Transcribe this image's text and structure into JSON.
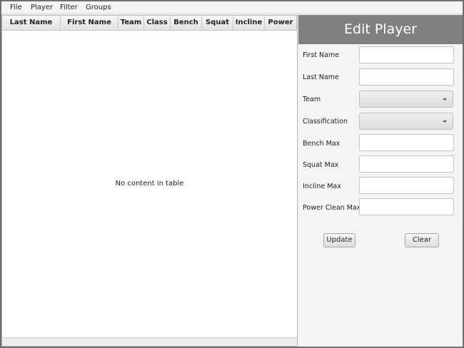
{
  "menu": [
    "File",
    "Player",
    "Filter",
    "Groups"
  ],
  "table": {
    "columns": [
      "Last Name",
      "First Name",
      "Team",
      "Class",
      "Bench",
      "Squat",
      "Incline",
      "Power"
    ],
    "empty_text": "No content in table"
  },
  "panel": {
    "title": "Edit Player",
    "fields": {
      "first_name": {
        "label": "First Name",
        "value": ""
      },
      "last_name": {
        "label": "Last Name",
        "value": ""
      },
      "team": {
        "label": "Team",
        "value": ""
      },
      "classification": {
        "label": "Classification",
        "value": ""
      },
      "bench": {
        "label": "Bench Max",
        "value": ""
      },
      "squat": {
        "label": "Squat Max",
        "value": ""
      },
      "incline": {
        "label": "Incline Max",
        "value": ""
      },
      "power": {
        "label": "Power Clean Max",
        "value": ""
      }
    },
    "update_label": "Update",
    "clear_label": "Clear"
  }
}
